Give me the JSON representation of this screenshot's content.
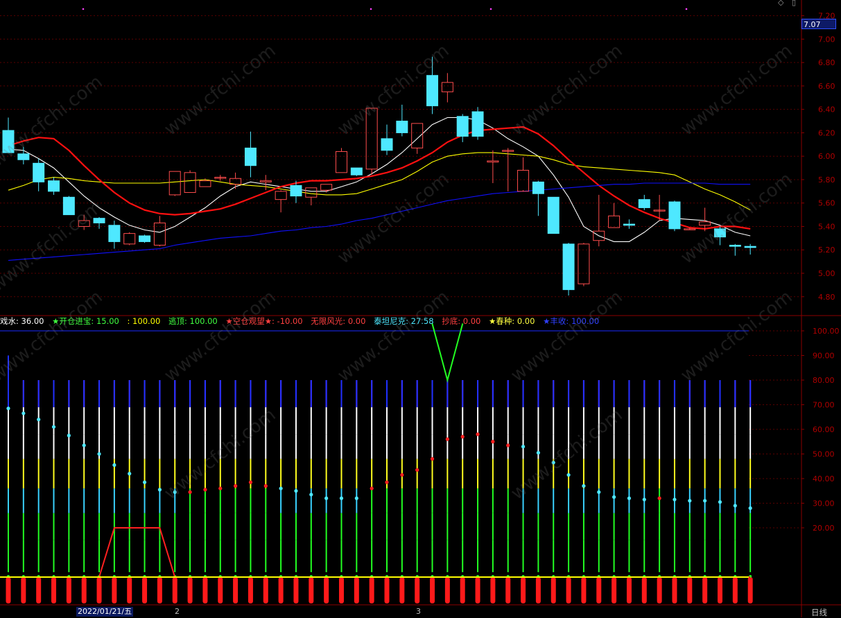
{
  "chart_data": [
    {
      "type": "candlestick",
      "price_axis": {
        "ticks": [
          7.2,
          7.0,
          6.8,
          6.6,
          6.4,
          6.2,
          6.0,
          5.8,
          5.6,
          5.4,
          5.2,
          5.0,
          4.8
        ]
      },
      "last_price": "7.07",
      "candles": [
        {
          "o": 6.22,
          "h": 6.33,
          "l": 6.03,
          "c": 6.03
        },
        {
          "o": 6.02,
          "h": 6.08,
          "l": 5.93,
          "c": 5.97
        },
        {
          "o": 5.94,
          "h": 5.98,
          "l": 5.7,
          "c": 5.78
        },
        {
          "o": 5.79,
          "h": 5.82,
          "l": 5.67,
          "c": 5.7
        },
        {
          "o": 5.65,
          "h": 5.66,
          "l": 5.5,
          "c": 5.5
        },
        {
          "o": 5.4,
          "h": 5.5,
          "l": 5.37,
          "c": 5.45
        },
        {
          "o": 5.47,
          "h": 5.48,
          "l": 5.38,
          "c": 5.43
        },
        {
          "o": 5.41,
          "h": 5.45,
          "l": 5.21,
          "c": 5.27
        },
        {
          "o": 5.25,
          "h": 5.35,
          "l": 5.24,
          "c": 5.34
        },
        {
          "o": 5.32,
          "h": 5.33,
          "l": 5.26,
          "c": 5.27
        },
        {
          "o": 5.24,
          "h": 5.49,
          "l": 5.23,
          "c": 5.43
        },
        {
          "o": 5.67,
          "h": 5.87,
          "l": 5.66,
          "c": 5.87
        },
        {
          "o": 5.69,
          "h": 5.88,
          "l": 5.69,
          "c": 5.86
        },
        {
          "o": 5.74,
          "h": 5.81,
          "l": 5.74,
          "c": 5.79
        },
        {
          "o": 5.82,
          "h": 5.84,
          "l": 5.79,
          "c": 5.82
        },
        {
          "o": 5.76,
          "h": 5.86,
          "l": 5.72,
          "c": 5.81
        },
        {
          "o": 6.07,
          "h": 6.21,
          "l": 5.82,
          "c": 5.92
        },
        {
          "o": 5.78,
          "h": 5.84,
          "l": 5.71,
          "c": 5.79
        },
        {
          "o": 5.63,
          "h": 5.71,
          "l": 5.52,
          "c": 5.7
        },
        {
          "o": 5.75,
          "h": 5.79,
          "l": 5.6,
          "c": 5.66
        },
        {
          "o": 5.65,
          "h": 5.73,
          "l": 5.58,
          "c": 5.73
        },
        {
          "o": 5.71,
          "h": 5.76,
          "l": 5.69,
          "c": 5.76
        },
        {
          "o": 5.86,
          "h": 6.07,
          "l": 5.86,
          "c": 6.04
        },
        {
          "o": 5.9,
          "h": 5.9,
          "l": 5.83,
          "c": 5.84
        },
        {
          "o": 5.89,
          "h": 6.41,
          "l": 5.84,
          "c": 6.41
        },
        {
          "o": 6.15,
          "h": 6.27,
          "l": 6.01,
          "c": 6.05
        },
        {
          "o": 6.3,
          "h": 6.44,
          "l": 6.17,
          "c": 6.2
        },
        {
          "o": 6.07,
          "h": 6.28,
          "l": 6.02,
          "c": 6.28
        },
        {
          "o": 6.69,
          "h": 6.85,
          "l": 6.36,
          "c": 6.43
        },
        {
          "o": 6.55,
          "h": 6.71,
          "l": 6.46,
          "c": 6.63
        },
        {
          "o": 6.34,
          "h": 6.36,
          "l": 6.12,
          "c": 6.17
        },
        {
          "o": 6.38,
          "h": 6.42,
          "l": 6.14,
          "c": 6.17
        },
        {
          "o": 5.95,
          "h": 6.05,
          "l": 5.77,
          "c": 5.96
        },
        {
          "o": 6.05,
          "h": 6.07,
          "l": 5.7,
          "c": 6.05
        },
        {
          "o": 5.7,
          "h": 5.99,
          "l": 5.71,
          "c": 5.88
        },
        {
          "o": 5.78,
          "h": 5.79,
          "l": 5.49,
          "c": 5.68
        },
        {
          "o": 5.65,
          "h": 5.65,
          "l": 5.34,
          "c": 5.34
        },
        {
          "o": 5.25,
          "h": 5.26,
          "l": 4.81,
          "c": 4.86
        },
        {
          "o": 4.91,
          "h": 5.26,
          "l": 4.89,
          "c": 5.25
        },
        {
          "o": 5.28,
          "h": 5.67,
          "l": 5.23,
          "c": 5.36
        },
        {
          "o": 5.39,
          "h": 5.6,
          "l": 5.39,
          "c": 5.49
        },
        {
          "o": 5.42,
          "h": 5.46,
          "l": 5.38,
          "c": 5.41
        },
        {
          "o": 5.63,
          "h": 5.67,
          "l": 5.54,
          "c": 5.56
        },
        {
          "o": 5.54,
          "h": 5.67,
          "l": 5.45,
          "c": 5.54
        },
        {
          "o": 5.61,
          "h": 5.62,
          "l": 5.36,
          "c": 5.38
        },
        {
          "o": 5.38,
          "h": 5.39,
          "l": 5.37,
          "c": 5.38
        },
        {
          "o": 5.41,
          "h": 5.56,
          "l": 5.36,
          "c": 5.44
        },
        {
          "o": 5.38,
          "h": 5.4,
          "l": 5.24,
          "c": 5.31
        },
        {
          "o": 5.24,
          "h": 5.25,
          "l": 5.15,
          "c": 5.23
        },
        {
          "o": 5.23,
          "h": 5.25,
          "l": 5.16,
          "c": 5.22
        }
      ],
      "ma_lines": [
        {
          "color": "#ffffff",
          "values": [
            6.06,
            6.05,
            5.98,
            5.9,
            5.78,
            5.66,
            5.56,
            5.48,
            5.41,
            5.37,
            5.35,
            5.4,
            5.48,
            5.56,
            5.66,
            5.74,
            5.78,
            5.76,
            5.74,
            5.72,
            5.7,
            5.7,
            5.74,
            5.78,
            5.85,
            5.93,
            6.03,
            6.15,
            6.27,
            6.33,
            6.33,
            6.31,
            6.24,
            6.15,
            6.08,
            6.0,
            5.84,
            5.65,
            5.4,
            5.32,
            5.27,
            5.27,
            5.35,
            5.45,
            5.47,
            5.46,
            5.45,
            5.41,
            5.35,
            5.32
          ]
        },
        {
          "color": "#ffff00",
          "values": [
            5.71,
            5.75,
            5.8,
            5.82,
            5.81,
            5.79,
            5.78,
            5.77,
            5.77,
            5.77,
            5.77,
            5.78,
            5.79,
            5.8,
            5.78,
            5.76,
            5.75,
            5.74,
            5.72,
            5.7,
            5.68,
            5.67,
            5.67,
            5.68,
            5.72,
            5.76,
            5.8,
            5.87,
            5.95,
            6.0,
            6.02,
            6.03,
            6.03,
            6.02,
            6.01,
            6.0,
            5.97,
            5.93,
            5.91,
            5.9,
            5.89,
            5.88,
            5.87,
            5.86,
            5.84,
            5.78,
            5.72,
            5.67,
            5.61,
            5.54
          ]
        },
        {
          "color": "#ff1010",
          "values": [
            6.09,
            6.13,
            6.16,
            6.15,
            6.05,
            5.92,
            5.8,
            5.69,
            5.6,
            5.54,
            5.51,
            5.5,
            5.51,
            5.53,
            5.55,
            5.59,
            5.64,
            5.69,
            5.74,
            5.77,
            5.79,
            5.79,
            5.8,
            5.81,
            5.83,
            5.86,
            5.9,
            5.96,
            6.03,
            6.12,
            6.18,
            6.22,
            6.23,
            6.24,
            6.25,
            6.19,
            6.09,
            5.97,
            5.86,
            5.75,
            5.66,
            5.58,
            5.52,
            5.47,
            5.43,
            5.39,
            5.38,
            5.4,
            5.4,
            5.38
          ]
        },
        {
          "color": "#1010ff",
          "values": [
            5.11,
            5.12,
            5.13,
            5.14,
            5.15,
            5.16,
            5.17,
            5.18,
            5.19,
            5.2,
            5.21,
            5.24,
            5.26,
            5.28,
            5.3,
            5.31,
            5.32,
            5.34,
            5.36,
            5.37,
            5.39,
            5.4,
            5.42,
            5.45,
            5.47,
            5.5,
            5.53,
            5.56,
            5.59,
            5.62,
            5.64,
            5.66,
            5.68,
            5.69,
            5.7,
            5.71,
            5.72,
            5.73,
            5.74,
            5.75,
            5.76,
            5.76,
            5.77,
            5.77,
            5.77,
            5.77,
            5.77,
            5.76,
            5.76,
            5.76
          ]
        }
      ]
    },
    {
      "type": "indicator",
      "y_ticks": [
        100.0,
        90.0,
        80.0,
        70.0,
        60.0,
        50.0,
        40.0,
        30.0,
        20.0
      ],
      "dots": [
        {
          "v": 68.5,
          "color": "#4ee8ff"
        },
        {
          "v": 66.5,
          "color": "#4ee8ff"
        },
        {
          "v": 64.0,
          "color": "#4ee8ff"
        },
        {
          "v": 61.0,
          "color": "#4ee8ff"
        },
        {
          "v": 57.5,
          "color": "#4ee8ff"
        },
        {
          "v": 53.5,
          "color": "#4ee8ff"
        },
        {
          "v": 50.0,
          "color": "#4ee8ff"
        },
        {
          "v": 45.5,
          "color": "#4ee8ff"
        },
        {
          "v": 42.0,
          "color": "#4ee8ff"
        },
        {
          "v": 38.5,
          "color": "#4ee8ff"
        },
        {
          "v": 35.5,
          "color": "#4ee8ff"
        },
        {
          "v": 34.5,
          "color": "#4ee8ff"
        },
        {
          "v": 34.5,
          "color": "#ff2020"
        },
        {
          "v": 35.5,
          "color": "#ff2020"
        },
        {
          "v": 36.0,
          "color": "#ff2020"
        },
        {
          "v": 37.0,
          "color": "#ff2020"
        },
        {
          "v": 38.5,
          "color": "#ff2020"
        },
        {
          "v": 37.0,
          "color": "#ff2020"
        },
        {
          "v": 36.0,
          "color": "#4ee8ff"
        },
        {
          "v": 35.0,
          "color": "#4ee8ff"
        },
        {
          "v": 33.5,
          "color": "#4ee8ff"
        },
        {
          "v": 32.0,
          "color": "#4ee8ff"
        },
        {
          "v": 32.0,
          "color": "#4ee8ff"
        },
        {
          "v": 32.0,
          "color": "#4ee8ff"
        },
        {
          "v": 36.0,
          "color": "#ff2020"
        },
        {
          "v": 38.5,
          "color": "#ff2020"
        },
        {
          "v": 41.5,
          "color": "#ff2020"
        },
        {
          "v": 43.5,
          "color": "#ff2020"
        },
        {
          "v": 48.0,
          "color": "#ff2020"
        },
        {
          "v": 56.0,
          "color": "#ff2020"
        },
        {
          "v": 57.0,
          "color": "#ff2020"
        },
        {
          "v": 58.0,
          "color": "#ff2020"
        },
        {
          "v": 55.0,
          "color": "#ff2020"
        },
        {
          "v": 53.5,
          "color": "#ff2020"
        },
        {
          "v": 53.0,
          "color": "#4ee8ff"
        },
        {
          "v": 50.5,
          "color": "#4ee8ff"
        },
        {
          "v": 46.5,
          "color": "#4ee8ff"
        },
        {
          "v": 41.5,
          "color": "#4ee8ff"
        },
        {
          "v": 37.0,
          "color": "#4ee8ff"
        },
        {
          "v": 34.5,
          "color": "#4ee8ff"
        },
        {
          "v": 32.5,
          "color": "#4ee8ff"
        },
        {
          "v": 32.0,
          "color": "#4ee8ff"
        },
        {
          "v": 31.5,
          "color": "#4ee8ff"
        },
        {
          "v": 32.0,
          "color": "#ff2020"
        },
        {
          "v": 31.5,
          "color": "#4ee8ff"
        },
        {
          "v": 31.0,
          "color": "#4ee8ff"
        },
        {
          "v": 31.0,
          "color": "#4ee8ff"
        },
        {
          "v": 30.5,
          "color": "#4ee8ff"
        },
        {
          "v": 29.0,
          "color": "#4ee8ff"
        },
        {
          "v": 28.0,
          "color": "#4ee8ff"
        }
      ],
      "red_line": [
        0,
        0,
        0,
        0,
        0,
        0,
        0,
        20,
        20,
        20,
        20,
        0,
        0,
        0,
        0,
        0,
        0,
        0,
        0,
        0,
        0,
        0,
        0,
        0,
        0,
        0,
        0,
        0,
        0,
        0,
        0,
        0,
        0,
        0,
        0,
        0,
        0,
        0,
        0,
        0,
        0,
        0,
        0,
        0,
        0,
        0,
        0,
        0,
        0,
        0
      ],
      "v_marker": {
        "index": 29,
        "top": 100,
        "bottom": 80
      },
      "base_line": 0,
      "top_line": 100,
      "readout": [
        {
          "text": "戏水: 36.00",
          "color": "#ffffff"
        },
        {
          "text": "★开仓进宝: 15.00",
          "color": "#40ff40"
        },
        {
          "text": ": 100.00",
          "color": "#ffff00"
        },
        {
          "text": "逃顶: 100.00",
          "color": "#40ff40"
        },
        {
          "text": "★空仓观望★: -10.00",
          "color": "#ff4040"
        },
        {
          "text": "无限风光: 0.00",
          "color": "#ff4040"
        },
        {
          "text": "泰坦尼克: 27.58",
          "color": "#4ee8ff"
        },
        {
          "text": "抄底: 0.00",
          "color": "#ff4040"
        },
        {
          "text": "★春种: 0.00",
          "color": "#ffff40"
        },
        {
          "text": "★丰收: 100.00",
          "color": "#3040ff"
        }
      ]
    }
  ],
  "x_axis": {
    "labels": [
      "2022/01/21/五",
      "2",
      "3"
    ]
  },
  "corner_label": "日线",
  "watermark_text": "www.cfchi.com"
}
